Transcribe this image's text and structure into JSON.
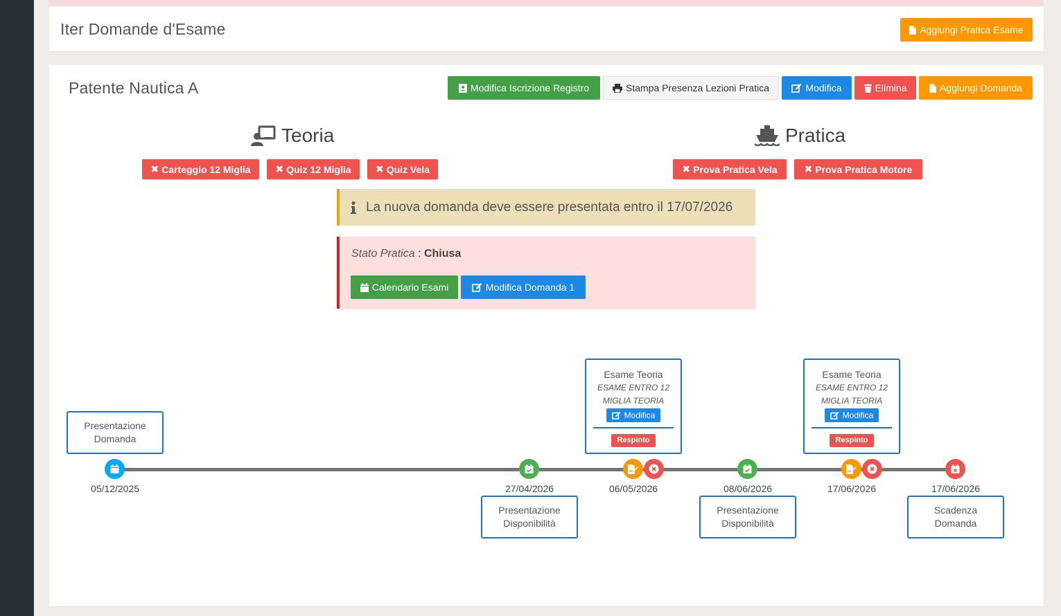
{
  "header": {
    "title": "Iter Domande d'Esame",
    "add_button": "Aggiungi Pratica Esame"
  },
  "pratica": {
    "title": "Patente Nautica A",
    "buttons": {
      "modifica_iscrizione": "Modifica Iscrizione Registro",
      "stampa_presenza": "Stampa Presenza Lezioni Pratica",
      "modifica": "Modifica",
      "elimina": "Elimina",
      "aggiungi_domanda": "Aggiungi Domanda"
    },
    "teoria": {
      "title": "Teoria",
      "tags": [
        "Carteggio 12 Miglia",
        "Quiz 12 Miglia",
        "Quiz Vela"
      ]
    },
    "pratica_section": {
      "title": "Pratica",
      "tags": [
        "Prova Pratica Vela",
        "Prova Pratica Motore"
      ]
    },
    "warning": "La nuova domanda deve essere presentata entro il 17/07/2026",
    "stato": {
      "label": "Stato Pratica",
      "separator": ":",
      "value": "Chiusa",
      "calendario_button": "Calendario Esami",
      "modifica_domanda_button": "Modifica Domanda 1"
    }
  },
  "timeline": {
    "dates": [
      "05/12/2025",
      "27/04/2026",
      "06/05/2026",
      "08/06/2026",
      "17/06/2026",
      "17/06/2026"
    ],
    "events": {
      "presentazione_domanda": "Presentazione Domanda",
      "disponibilita_1": "Presentazione Disponibilità",
      "disponibilita_2": "Presentazione Disponibilità",
      "scadenza": "Scadenza Domanda"
    },
    "exams": [
      {
        "title": "Esame Teoria",
        "subtitle": "ESAME ENTRO 12 MIGLIA TEORIA",
        "button": "Modifica",
        "result": "Respinto"
      },
      {
        "title": "Esame Teoria",
        "subtitle": "ESAME ENTRO 12 MIGLIA TEORIA",
        "button": "Modifica",
        "result": "Respinto"
      }
    ]
  },
  "colors": {
    "orange": "#ff9800",
    "green": "#43a047",
    "blue": "#1e88e5",
    "red": "#ef5350",
    "cyan": "#03a9f4",
    "sidebar": "#263238"
  }
}
